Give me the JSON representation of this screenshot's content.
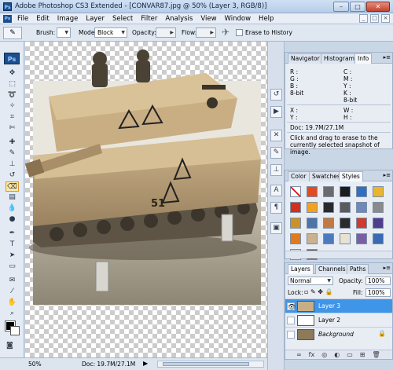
{
  "window": {
    "title": "Adobe Photoshop CS3 Extended - [CONVAR87.jpg @ 50% (Layer 3, RGB/8)]",
    "app_badge": "Ps",
    "buttons": {
      "minimize": "–",
      "maximize": "□",
      "close": "✕"
    }
  },
  "menubar": {
    "items": [
      "File",
      "Edit",
      "Image",
      "Layer",
      "Select",
      "Filter",
      "Analysis",
      "View",
      "Window",
      "Help"
    ],
    "doc_controls": [
      "_",
      "□",
      "×"
    ]
  },
  "options": {
    "brush_label": "Brush:",
    "mode_label": "Mode:",
    "mode_value": "Block",
    "opacity_label": "Opacity:",
    "flow_label": "Flow:",
    "erase_to_history": "Erase to History"
  },
  "toolbox": {
    "badge": "Ps",
    "tools": [
      "move-tool",
      "marquee-tool",
      "lasso-tool",
      "quick-selection-tool",
      "crop-tool",
      "slice-tool",
      "healing-brush-tool",
      "brush-tool",
      "clone-stamp-tool",
      "history-brush-tool",
      "eraser-tool",
      "gradient-tool",
      "blur-tool",
      "dodge-tool",
      "pen-tool",
      "type-tool",
      "path-selection-tool",
      "shape-tool",
      "notes-tool",
      "eyedropper-tool",
      "hand-tool",
      "zoom-tool"
    ],
    "active_tool": "eraser-tool"
  },
  "status": {
    "zoom": "50%",
    "doc": "Doc: 19.7M/27.1M"
  },
  "info_panel": {
    "tabs": [
      "Navigator",
      "Histogram",
      "Info"
    ],
    "active_tab": "Info",
    "rgb_labels": [
      "R :",
      "G :",
      "B :"
    ],
    "cmyk_labels": [
      "C :",
      "M :",
      "Y :",
      "K :"
    ],
    "bit_left": "8-bit",
    "bit_right": "8-bit",
    "xy_labels": [
      "X :",
      "Y :"
    ],
    "wh_labels": [
      "W :",
      "H :"
    ],
    "doc": "Doc: 19.7M/27.1M",
    "hint": "Click and drag to erase to the currently selected snapshot of image."
  },
  "swatches_panel": {
    "tabs": [
      "Color",
      "Swatches",
      "Styles"
    ],
    "active_tab": "Styles",
    "style_colors": [
      "#ffffff",
      "#e24b1f",
      "#6b6b6b",
      "#1d1d1d",
      "#2f6fc4",
      "#e8b52c",
      "#d1301f",
      "#f3a21e",
      "#2a2a2a",
      "#5b5b5b",
      "#6d8ab8",
      "#8a8a8a",
      "#c9922c",
      "#4d74a8",
      "#c27a45",
      "#2b2b2b",
      "#cf3b2d",
      "#4e3e8d",
      "#e07a1c",
      "#c9b28c",
      "#4c7bbd",
      "#e7e2d2",
      "#7a5ea4",
      "#3a6ab1",
      "#d9d9d9",
      "#595959"
    ]
  },
  "layers_panel": {
    "tabs": [
      "Layers",
      "Channels",
      "Paths"
    ],
    "active_tab": "Layers",
    "blend_mode": "Normal",
    "opacity_label": "Opacity:",
    "opacity_value": "100%",
    "lock_label": "Lock:",
    "fill_label": "Fill:",
    "fill_value": "100%",
    "layers": [
      {
        "name": "Layer 3",
        "selected": true,
        "visible": true
      },
      {
        "name": "Layer 2",
        "selected": false,
        "visible": false
      },
      {
        "name": "Background",
        "selected": false,
        "visible": false,
        "locked": true
      }
    ],
    "footer_icons": [
      "link-icon",
      "fx-icon",
      "mask-icon",
      "adjustment-icon",
      "folder-icon",
      "new-layer-icon",
      "trash-icon"
    ]
  }
}
